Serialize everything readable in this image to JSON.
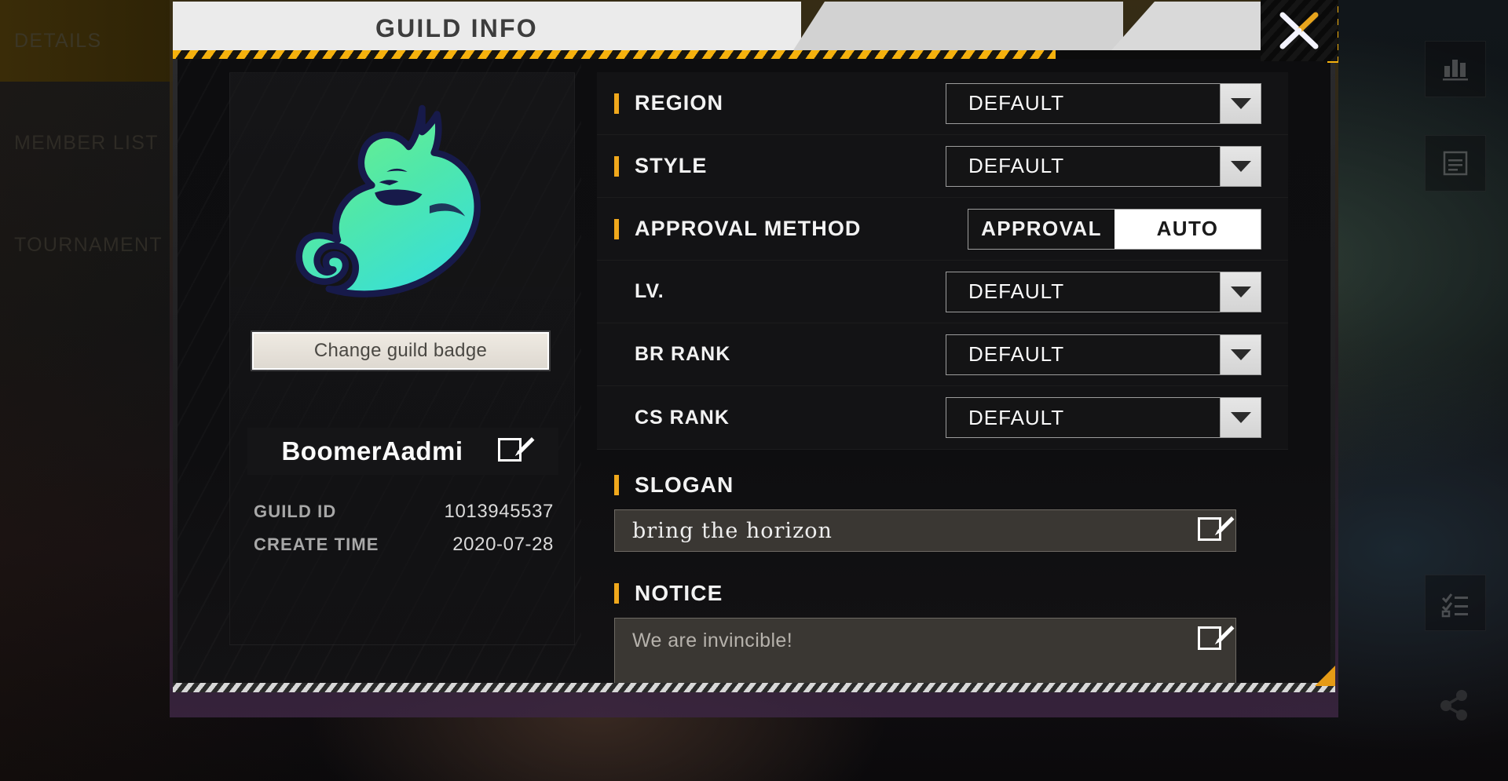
{
  "window": {
    "title": "GUILD INFO",
    "close_icon": "close-x-icon"
  },
  "sidebar": {
    "items": [
      {
        "label": "DETAILS",
        "active": true
      },
      {
        "label": "MEMBER LIST",
        "active": false
      },
      {
        "label": "TOURNAMENT",
        "active": false
      }
    ]
  },
  "rail": {
    "items": [
      {
        "name": "stats-icon"
      },
      {
        "name": "document-icon"
      },
      {
        "name": "checklist-icon"
      },
      {
        "name": "share-icon"
      }
    ]
  },
  "guild": {
    "badge_alt": "guild-badge",
    "change_badge_label": "Change guild badge",
    "name": "BoomerAadmi",
    "meta": [
      {
        "key": "GUILD ID",
        "value": "1013945537"
      },
      {
        "key": "CREATE TIME",
        "value": "2020-07-28"
      }
    ]
  },
  "settings": {
    "rows": [
      {
        "label": "REGION",
        "accent": true,
        "control": "dropdown",
        "value": "DEFAULT"
      },
      {
        "label": "STYLE",
        "accent": true,
        "control": "dropdown",
        "value": "DEFAULT"
      },
      {
        "label": "APPROVAL METHOD",
        "accent": true,
        "control": "toggle",
        "options": [
          {
            "label": "APPROVAL",
            "selected": false
          },
          {
            "label": "AUTO",
            "selected": true
          }
        ]
      },
      {
        "label": "LV.",
        "accent": false,
        "control": "dropdown",
        "value": "DEFAULT"
      },
      {
        "label": "BR RANK",
        "accent": false,
        "control": "dropdown",
        "value": "DEFAULT"
      },
      {
        "label": "CS RANK",
        "accent": false,
        "control": "dropdown",
        "value": "DEFAULT"
      }
    ]
  },
  "slogan": {
    "label": "SLOGAN",
    "value": "bring the horizon",
    "edit_icon": "edit-pencil-icon"
  },
  "notice": {
    "label": "NOTICE",
    "value": "We are invincible!",
    "edit_icon": "edit-pencil-icon"
  },
  "colors": {
    "accent_orange": "#f0a81c",
    "hazard_yellow": "#f5b10d",
    "header_plate": "#ebebeb",
    "badge_green": "#5ee890",
    "badge_cyan": "#3de0d8",
    "badge_outline": "#171a4a",
    "panel_bg": "#0e0e10",
    "field_bg": "#3a3733"
  }
}
